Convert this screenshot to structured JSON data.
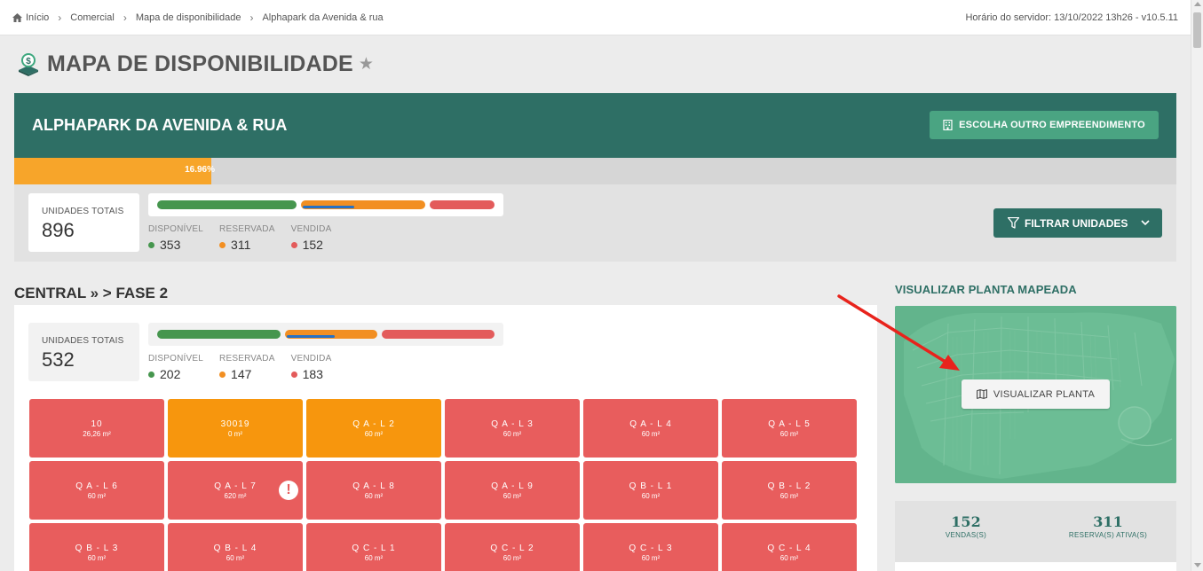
{
  "breadcrumb": {
    "items": [
      "Início",
      "Comercial",
      "Mapa de disponibilidade",
      "Alphapark da Avenida & rua"
    ]
  },
  "server_time": "Horário do servidor: 13/10/2022 13h26 - v10.5.11",
  "page": {
    "title": "MAPA DE DISPONIBILIDADE"
  },
  "header": {
    "project_name": "ALPHAPARK DA AVENIDA & RUA",
    "choose_button": "ESCOLHA OUTRO EMPREENDIMENTO",
    "progress_label": "16.96%",
    "progress_fraction": 0.1696
  },
  "totals": {
    "units_label": "UNIDADES TOTAIS",
    "units_value": "896",
    "available_label": "DISPONÍVEL",
    "available_value": "353",
    "reserved_label": "RESERVADA",
    "reserved_value": "311",
    "sold_label": "VENDIDA",
    "sold_value": "152"
  },
  "filter_button": "FILTRAR UNIDADES",
  "section": {
    "title": "CENTRAL » > FASE 2",
    "units_label": "UNIDADES TOTAIS",
    "units_value": "532",
    "available_label": "DISPONÍVEL",
    "available_value": "202",
    "reserved_label": "RESERVADA",
    "reserved_value": "147",
    "sold_label": "VENDIDA",
    "sold_value": "183"
  },
  "units": [
    {
      "name": "10",
      "area": "26,26 m²",
      "status": "red"
    },
    {
      "name": "30019",
      "area": "0 m²",
      "status": "orange"
    },
    {
      "name": "Q A - L 2",
      "area": "60 m²",
      "status": "orange"
    },
    {
      "name": "Q A - L 3",
      "area": "60 m²",
      "status": "red"
    },
    {
      "name": "Q A - L 4",
      "area": "60 m²",
      "status": "red"
    },
    {
      "name": "Q A - L 5",
      "area": "60 m²",
      "status": "red"
    },
    {
      "name": "Q A - L 6",
      "area": "60 m²",
      "status": "red"
    },
    {
      "name": "Q A - L 7",
      "area": "620 m²",
      "status": "red",
      "alert": true
    },
    {
      "name": "Q A - L 8",
      "area": "60 m²",
      "status": "red"
    },
    {
      "name": "Q A - L 9",
      "area": "60 m²",
      "status": "red"
    },
    {
      "name": "Q B - L 1",
      "area": "60 m²",
      "status": "red"
    },
    {
      "name": "Q B - L 2",
      "area": "60 m²",
      "status": "red"
    },
    {
      "name": "Q B - L 3",
      "area": "60 m²",
      "status": "red"
    },
    {
      "name": "Q B - L 4",
      "area": "60 m²",
      "status": "red"
    },
    {
      "name": "Q C - L 1",
      "area": "60 m²",
      "status": "red"
    },
    {
      "name": "Q C - L 2",
      "area": "60 m²",
      "status": "red"
    },
    {
      "name": "Q C - L 3",
      "area": "60 m²",
      "status": "red"
    },
    {
      "name": "Q C - L 4",
      "area": "60 m²",
      "status": "red"
    }
  ],
  "map": {
    "heading": "VISUALIZAR PLANTA MAPEADA",
    "button": "VISUALIZAR PLANTA"
  },
  "sales": {
    "sales_value": "152",
    "sales_label": "VENDAS(S)",
    "reserves_value": "311",
    "reserves_label": "RESERVA(S) ATIVA(S)"
  },
  "colors": {
    "brand_dark": "#2e6f65",
    "brand_light": "#4aa482",
    "progress": "#f7a52a",
    "sold_red": "#e85d5d",
    "reserved_orange": "#f7960d",
    "available_green": "#46964e"
  },
  "icons": [
    "home-icon",
    "money-icon",
    "star-icon",
    "building-icon",
    "filter-icon",
    "chevron-down-icon",
    "alert-icon",
    "map-icon"
  ]
}
